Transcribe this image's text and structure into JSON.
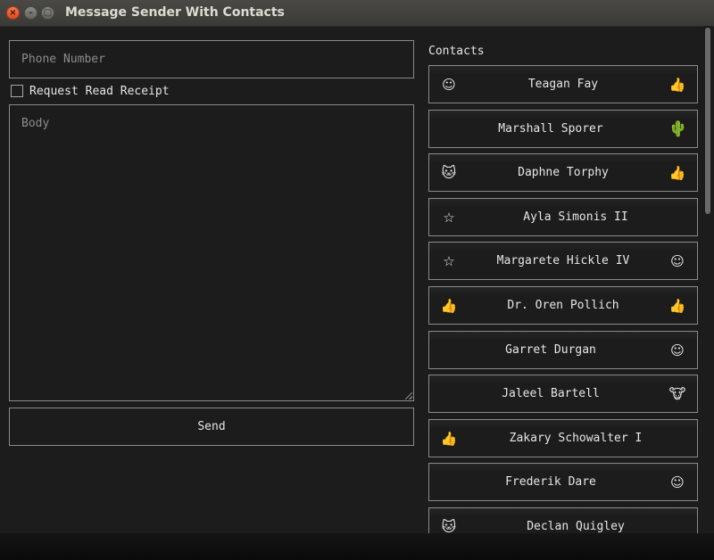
{
  "window": {
    "title": "Message Sender With Contacts",
    "close_glyph": "×",
    "min_glyph": "–",
    "max_glyph": "□"
  },
  "form": {
    "phone_placeholder": "Phone Number",
    "receipt_label": "Request Read Receipt",
    "receipt_checked": false,
    "body_placeholder": "Body",
    "send_label": "Send"
  },
  "contacts": {
    "title": "Contacts",
    "items": [
      {
        "name": "Teagan Fay",
        "left_icon": "smiley-icon",
        "right_icon": "thumbs-up-icon"
      },
      {
        "name": "Marshall Sporer",
        "left_icon": null,
        "right_icon": "cactus-icon"
      },
      {
        "name": "Daphne Torphy",
        "left_icon": "cat-icon",
        "right_icon": "thumbs-up-icon"
      },
      {
        "name": "Ayla Simonis II",
        "left_icon": "star-icon",
        "right_icon": null
      },
      {
        "name": "Margarete Hickle IV",
        "left_icon": "star-icon",
        "right_icon": "smiley-icon"
      },
      {
        "name": "Dr. Oren Pollich",
        "left_icon": "thumbs-up-icon",
        "right_icon": "thumbs-up-icon"
      },
      {
        "name": "Garret Durgan",
        "left_icon": null,
        "right_icon": "smiley-icon"
      },
      {
        "name": "Jaleel Bartell",
        "left_icon": null,
        "right_icon": "cow-icon"
      },
      {
        "name": "Zakary Schowalter I",
        "left_icon": "thumbs-up-icon",
        "right_icon": null
      },
      {
        "name": "Frederik Dare",
        "left_icon": null,
        "right_icon": "smiley-icon"
      },
      {
        "name": "Declan Quigley",
        "left_icon": "cat-icon",
        "right_icon": null
      }
    ]
  },
  "colors": {
    "background": "#1c1c1c",
    "border": "#8a8a8a",
    "text": "#e6e6e6",
    "placeholder": "#8c8c8c",
    "titlebar": "#3b3a37",
    "close_button": "#df4a1a",
    "cactus": "#6aa84f"
  }
}
